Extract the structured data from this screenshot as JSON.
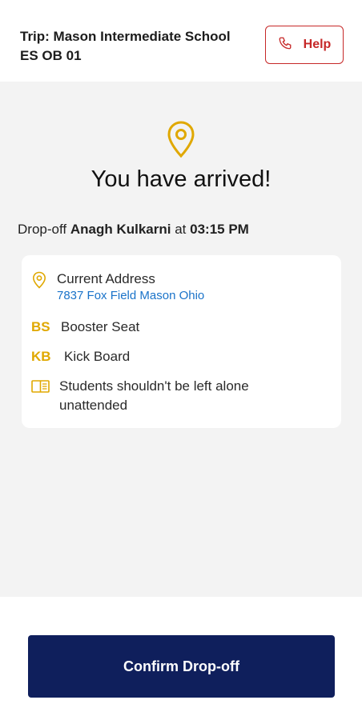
{
  "header": {
    "trip_title_line1": "Trip: Mason Intermediate School",
    "trip_title_line2": "ES OB 01",
    "help_label": "Help"
  },
  "main": {
    "arrived_title": "You have arrived!",
    "dropoff": {
      "prefix": "Drop-off",
      "student_name": "Anagh Kulkarni",
      "at": "at",
      "time": "03:15 PM"
    },
    "card": {
      "address_label": "Current Address",
      "address_value": "7837 Fox Field Mason Ohio",
      "items": [
        {
          "code": "BS",
          "label": "Booster Seat"
        },
        {
          "code": "KB",
          "label": "Kick Board"
        }
      ],
      "note_line1": "Students shouldn't be left alone",
      "note_line2": "unattended"
    }
  },
  "footer": {
    "confirm_label": "Confirm Drop-off"
  },
  "colors": {
    "accent": "#e0a800",
    "danger": "#c62828",
    "primary": "#0f1f5c",
    "link": "#1a73c9"
  },
  "icons": [
    "phone-icon",
    "location-pin-icon",
    "book-icon"
  ]
}
